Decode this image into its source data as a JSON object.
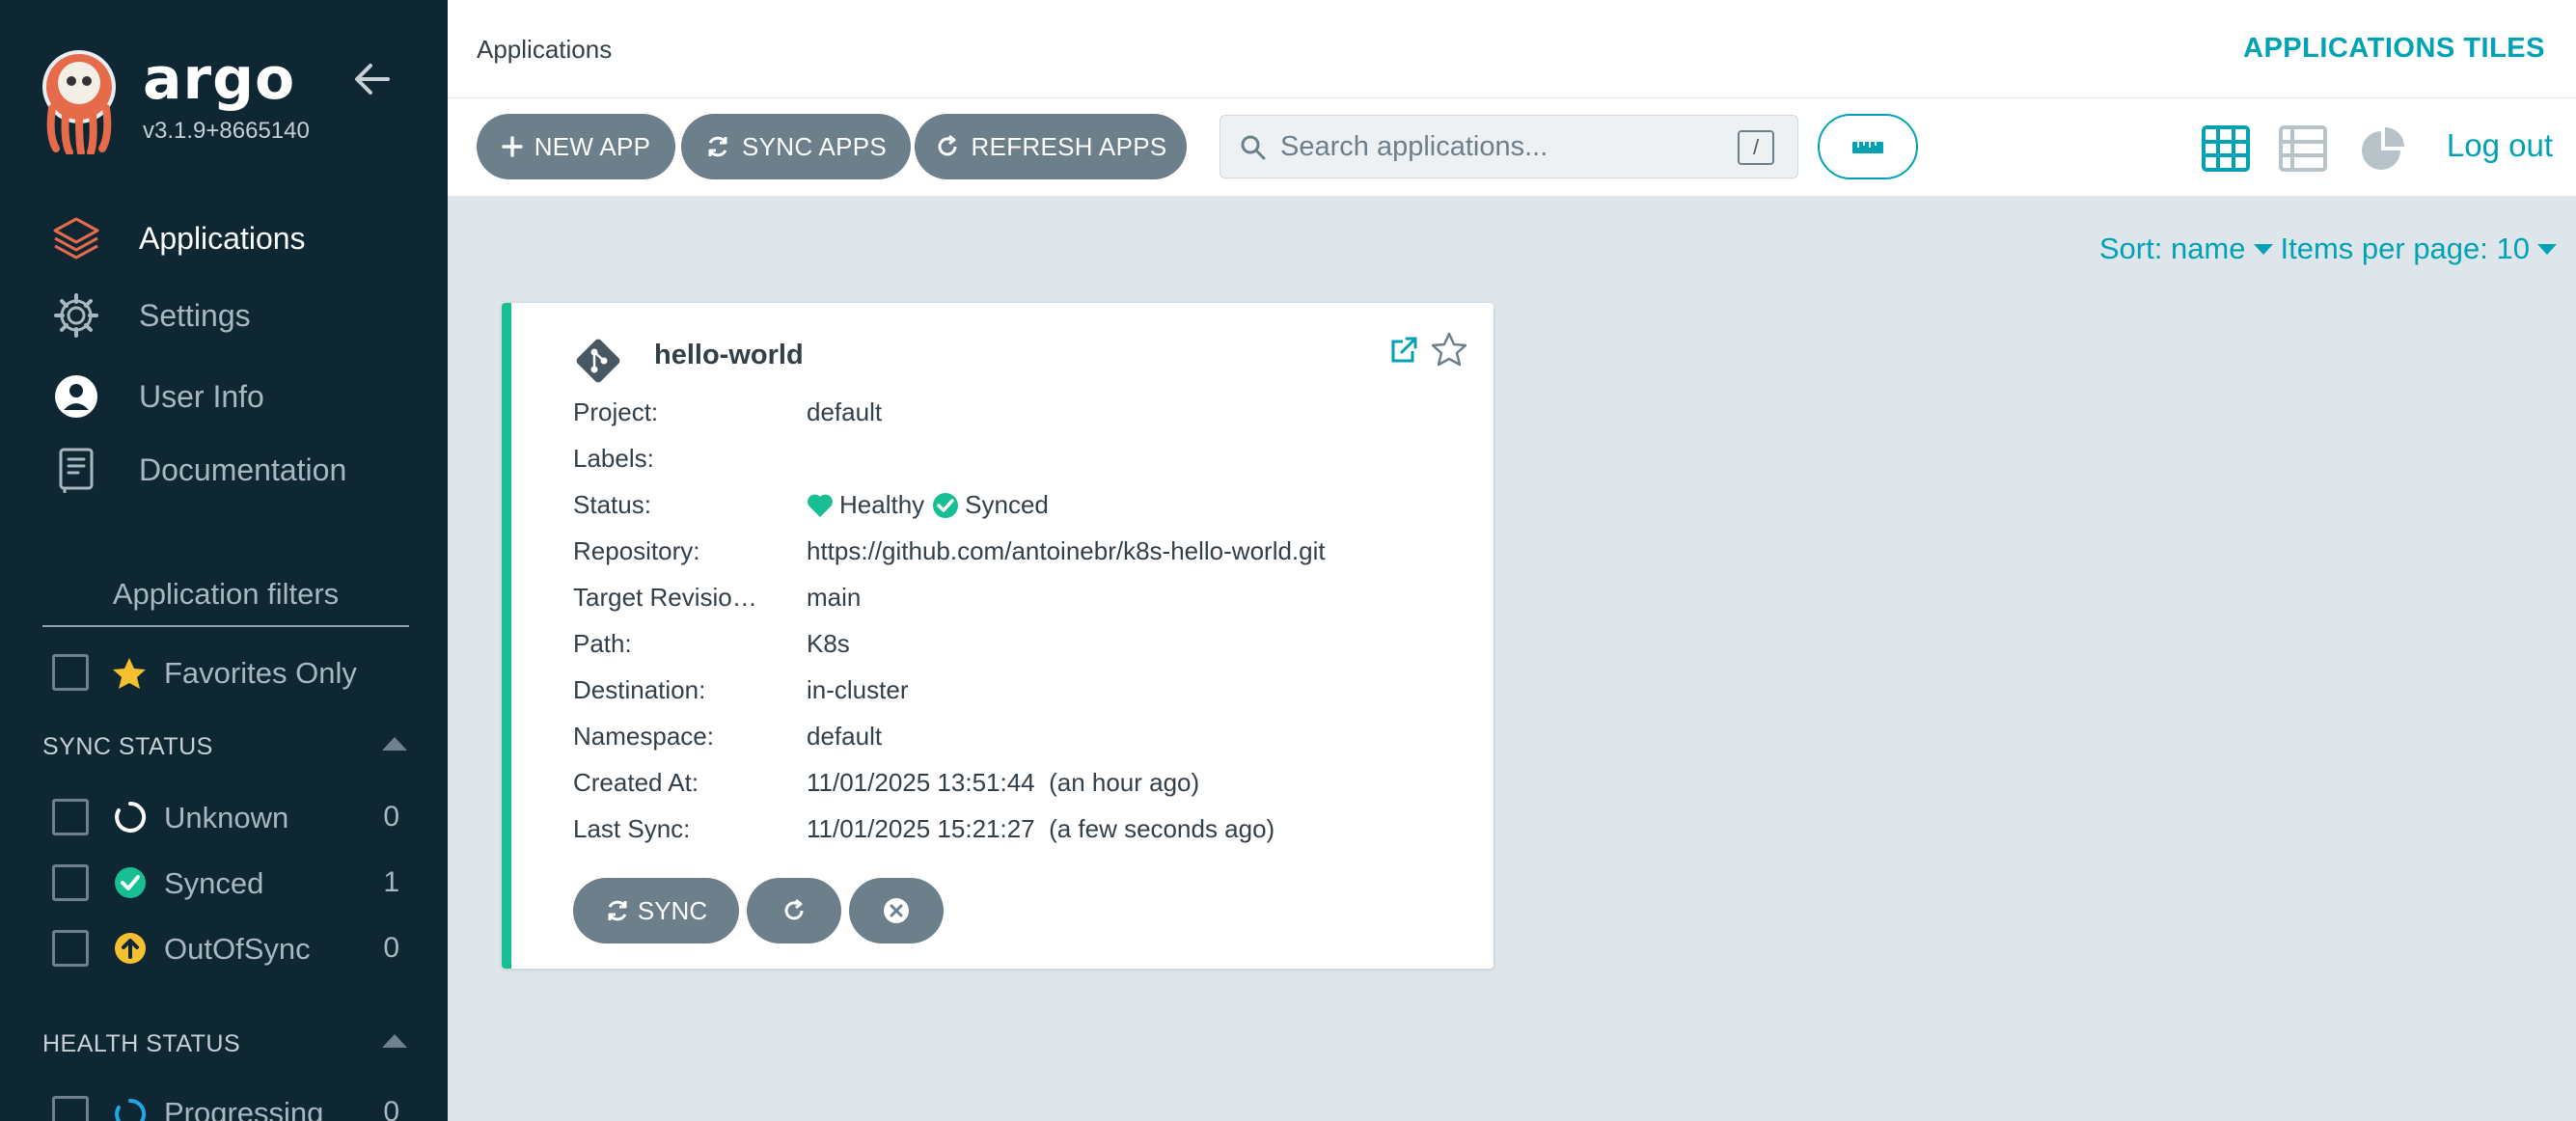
{
  "brand": {
    "name": "argo",
    "version": "v3.1.9+8665140"
  },
  "nav": [
    {
      "label": "Applications",
      "icon": "layers-icon",
      "active": true
    },
    {
      "label": "Settings",
      "icon": "gear-icon"
    },
    {
      "label": "User Info",
      "icon": "user-circle-icon"
    },
    {
      "label": "Documentation",
      "icon": "book-icon"
    }
  ],
  "filters": {
    "title": "Application filters",
    "favorites_label": "Favorites Only",
    "sync_status": {
      "title": "SYNC STATUS",
      "items": [
        {
          "label": "Unknown",
          "count": "0",
          "icon": "circle-notch-icon"
        },
        {
          "label": "Synced",
          "count": "1",
          "icon": "check-circle-icon"
        },
        {
          "label": "OutOfSync",
          "count": "0",
          "icon": "arrow-up-circle-icon"
        }
      ]
    },
    "health_status": {
      "title": "HEALTH STATUS",
      "items": [
        {
          "label": "Progressing",
          "count": "0",
          "icon": "spinner-icon"
        }
      ]
    }
  },
  "header": {
    "title": "Applications",
    "view_title": "APPLICATIONS TILES"
  },
  "toolbar": {
    "new_app": "NEW APP",
    "sync_apps": "SYNC APPS",
    "refresh_apps": "REFRESH APPS",
    "search_placeholder": "Search applications...",
    "search_shortcut": "/",
    "logout": "Log out"
  },
  "sort": {
    "sort_label": "Sort: name",
    "per_page_label": "Items per page: 10"
  },
  "app": {
    "name": "hello-world",
    "rows": [
      {
        "key": "Project:",
        "value": "default"
      },
      {
        "key": "Labels:",
        "value": ""
      },
      {
        "key": "Status:",
        "value": ""
      },
      {
        "key": "Repository:",
        "value": "https://github.com/antoinebr/k8s-hello-world.git"
      },
      {
        "key": "Target Revisio…",
        "value": "main"
      },
      {
        "key": "Path:",
        "value": "K8s"
      },
      {
        "key": "Destination:",
        "value": "in-cluster"
      },
      {
        "key": "Namespace:",
        "value": "default"
      },
      {
        "key": "Created At:",
        "value": "11/01/2025 13:51:44  (an hour ago)"
      },
      {
        "key": "Last Sync:",
        "value": "11/01/2025 15:21:27  (a few seconds ago)"
      }
    ],
    "health": "Healthy",
    "sync": "Synced",
    "sync_button": "SYNC"
  },
  "colors": {
    "accent": "#00a2b3",
    "healthy": "#18be94",
    "sidebar": "#0f2733",
    "button": "#6d7f8b",
    "out_of_sync": "#f4c030"
  }
}
